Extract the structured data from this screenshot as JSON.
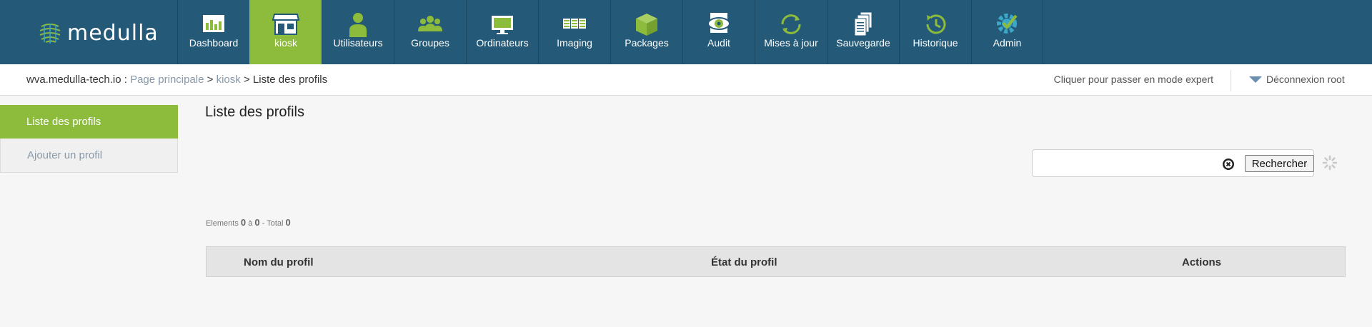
{
  "brand": {
    "name": "medulla",
    "accent": "#8dbb3c",
    "nav_bg": "#245a78"
  },
  "nav": [
    {
      "label": "Dashboard",
      "icon": "dashboard-icon",
      "active": false
    },
    {
      "label": "kiosk",
      "icon": "store-icon",
      "active": true
    },
    {
      "label": "Utilisateurs",
      "icon": "user-icon",
      "active": false
    },
    {
      "label": "Groupes",
      "icon": "group-icon",
      "active": false
    },
    {
      "label": "Ordinateurs",
      "icon": "monitor-icon",
      "active": false
    },
    {
      "label": "Imaging",
      "icon": "imaging-icon",
      "active": false
    },
    {
      "label": "Packages",
      "icon": "package-icon",
      "active": false
    },
    {
      "label": "Audit",
      "icon": "audit-icon",
      "active": false
    },
    {
      "label": "Mises à jour",
      "icon": "refresh-icon",
      "active": false
    },
    {
      "label": "Sauvegarde",
      "icon": "documents-icon",
      "active": false
    },
    {
      "label": "Historique",
      "icon": "history-icon",
      "active": false
    },
    {
      "label": "Admin",
      "icon": "gear-check-icon",
      "active": false
    }
  ],
  "breadcrumb": {
    "host": "wva.medulla-tech.io",
    "sep1": " : ",
    "home": "Page principale",
    "sep2": " > ",
    "module": "kiosk",
    "sep3": " > ",
    "current": "Liste des profils"
  },
  "header": {
    "expert_mode": "Cliquer pour passer en mode expert",
    "logout": "Déconnexion root"
  },
  "sidebar": {
    "items": [
      {
        "label": "Liste des profils",
        "active": true
      },
      {
        "label": "Ajouter un profil",
        "active": false
      }
    ]
  },
  "main": {
    "title": "Liste des profils",
    "search": {
      "value": "",
      "placeholder": "",
      "button": "Rechercher"
    },
    "counter": {
      "prefix": "Elements",
      "from": "0",
      "mid": "à",
      "to": "0",
      "total_label": "- Total",
      "total": "0"
    },
    "table": {
      "columns": [
        "Nom du profil",
        "État du profil",
        "Actions"
      ]
    }
  }
}
